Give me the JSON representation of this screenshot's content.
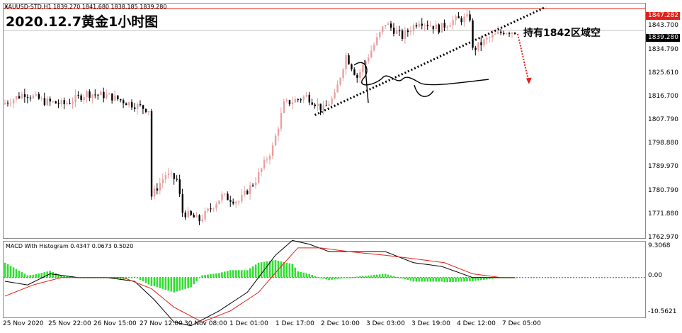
{
  "header": {
    "symbol_info": "XAUUSD-STD,H1  1839.270 1841.680 1838.185 1839.280",
    "title": "2020.12.7黄金1小时图",
    "annotation": "持有1842区域空"
  },
  "indicator": {
    "label": "MACD With Histogram 0.4347 0.0673 0.5020"
  },
  "price_axis": {
    "ticks": [
      "1843.700",
      "1834.790",
      "1825.610",
      "1816.700",
      "1807.790",
      "1798.880",
      "1789.970",
      "1780.790",
      "1771.880",
      "1762.970"
    ],
    "red_tag": "1847.282",
    "current_tag": "1839.280"
  },
  "macd_axis": {
    "ticks": [
      "9.3068",
      "0.00",
      "-10.5621"
    ]
  },
  "time_axis": {
    "labels": [
      "25 Nov 2020",
      "25 Nov 22:00",
      "26 Nov 15:00",
      "27 Nov 12:00",
      "30 Nov 08:00",
      "1 Dec 01:00",
      "1 Dec 17:00",
      "2 Dec 10:00",
      "3 Dec 03:00",
      "3 Dec 19:00",
      "4 Dec 12:00",
      "7 Dec 05:00"
    ]
  },
  "colors": {
    "bull": "#e8a0a0",
    "bear": "#000000",
    "red_line": "#e0201a",
    "grid_line": "#c0c0c0",
    "histogram": "#33dd33",
    "signal": "#e0201a",
    "macd": "#000000",
    "trendline": "#000000",
    "arrow": "#e0201a"
  },
  "chart_data": {
    "type": "candlestick",
    "price_range": [
      1762.97,
      1849
    ],
    "anchor_points": [
      [
        0,
        1812
      ],
      [
        8,
        1816
      ],
      [
        15,
        1813
      ],
      [
        22,
        1812
      ],
      [
        30,
        1816
      ],
      [
        38,
        1815
      ],
      [
        46,
        1812
      ],
      [
        52,
        1810
      ],
      [
        53,
        1778
      ],
      [
        58,
        1786
      ],
      [
        62,
        1784
      ],
      [
        64,
        1772
      ],
      [
        70,
        1769
      ],
      [
        78,
        1778
      ],
      [
        84,
        1776
      ],
      [
        90,
        1784
      ],
      [
        96,
        1796
      ],
      [
        100,
        1812
      ],
      [
        108,
        1815
      ],
      [
        114,
        1810
      ],
      [
        118,
        1815
      ],
      [
        122,
        1830
      ],
      [
        126,
        1822
      ],
      [
        132,
        1834
      ],
      [
        136,
        1842
      ],
      [
        142,
        1837
      ],
      [
        148,
        1843
      ],
      [
        155,
        1840
      ],
      [
        160,
        1843
      ],
      [
        166,
        1844
      ],
      [
        167,
        1832
      ],
      [
        172,
        1836
      ],
      [
        178,
        1839
      ],
      [
        182,
        1839
      ]
    ],
    "num_candles": 182,
    "seed": 7,
    "red_level": 1847.282,
    "gray_level": 1839.28,
    "macd_range": [
      -10.5621,
      9.3068
    ],
    "macd_anchor_points": [
      [
        0,
        -1
      ],
      [
        8,
        -2
      ],
      [
        16,
        1
      ],
      [
        26,
        0
      ],
      [
        36,
        0
      ],
      [
        46,
        -1
      ],
      [
        53,
        -6
      ],
      [
        60,
        -12
      ],
      [
        66,
        -13
      ],
      [
        76,
        -9
      ],
      [
        86,
        -4
      ],
      [
        96,
        6
      ],
      [
        102,
        10
      ],
      [
        108,
        9
      ],
      [
        115,
        7
      ],
      [
        125,
        7
      ],
      [
        135,
        7
      ],
      [
        145,
        4
      ],
      [
        155,
        3
      ],
      [
        166,
        0
      ],
      [
        175,
        0
      ],
      [
        182,
        0
      ]
    ],
    "signal_anchor_points": [
      [
        0,
        -5
      ],
      [
        10,
        -2
      ],
      [
        20,
        0
      ],
      [
        30,
        0
      ],
      [
        42,
        0
      ],
      [
        52,
        -3
      ],
      [
        60,
        -8
      ],
      [
        70,
        -12
      ],
      [
        80,
        -9
      ],
      [
        90,
        -4
      ],
      [
        98,
        3
      ],
      [
        104,
        8
      ],
      [
        112,
        8
      ],
      [
        122,
        7
      ],
      [
        135,
        6
      ],
      [
        146,
        5
      ],
      [
        156,
        4
      ],
      [
        166,
        1
      ],
      [
        176,
        0
      ],
      [
        182,
        0
      ]
    ],
    "trendline": {
      "from": [
        110,
        1808
      ],
      "to": [
        192,
        1848
      ]
    },
    "arrow": {
      "from": [
        182,
        1838
      ],
      "to": [
        186,
        1820
      ]
    }
  }
}
